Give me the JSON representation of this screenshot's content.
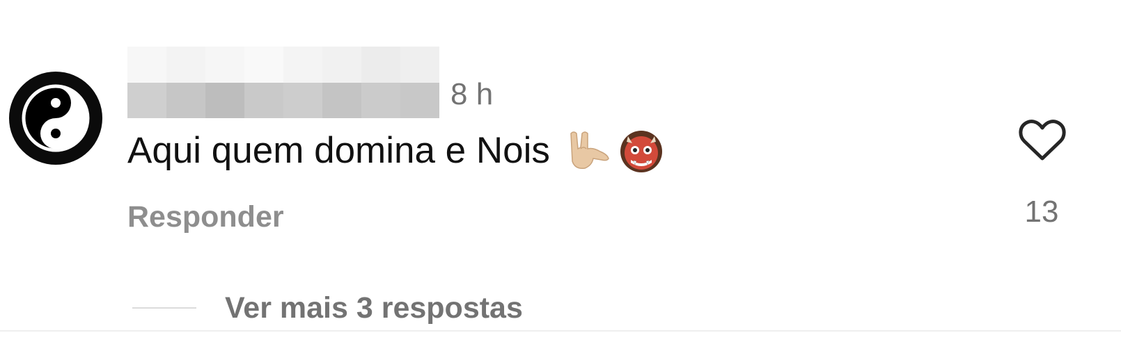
{
  "comment": {
    "avatar_icon": "yin-yang-icon",
    "timestamp": "8 h",
    "text": "Aqui quem domina e Nois",
    "emojis": [
      "love-you-gesture-icon",
      "ogre-mask-icon"
    ],
    "reply_label": "Responder",
    "like_icon": "heart-outline-icon",
    "like_count": "13"
  },
  "replies": {
    "label": "Ver mais 3 respostas"
  },
  "colors": {
    "text_primary": "#111111",
    "text_secondary": "#737373",
    "reply_gray": "#8e8e8e",
    "divider": "#dbdbdb"
  }
}
